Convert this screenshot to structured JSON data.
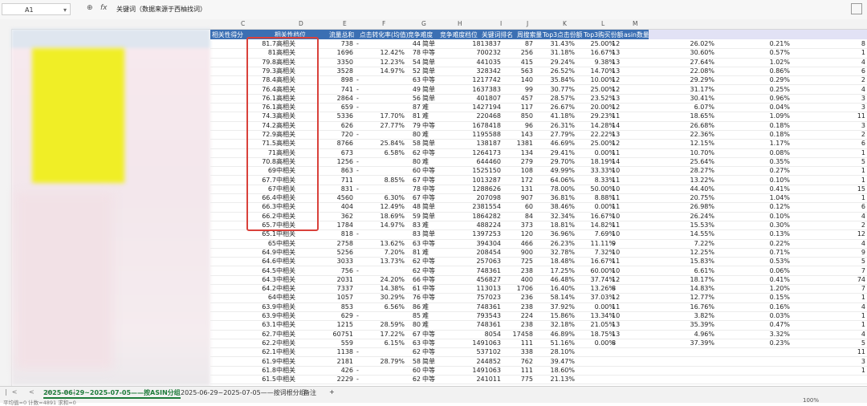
{
  "formula_bar": {
    "cell_ref": "A1",
    "fx_label": "fx",
    "content": "关键词（数据来源于西柚找词）"
  },
  "column_letters": [
    "C",
    "D",
    "E",
    "F",
    "G",
    "H",
    "I",
    "J",
    "K",
    "L",
    "M"
  ],
  "headers": [
    "相关性得分",
    "相关性档位",
    "流量总和",
    "点击转化率(均值)",
    "竞争难度",
    "竞争难度档位",
    "关键词排名",
    "周搜索量",
    "Top3点击份额",
    "Top3购买份额",
    "asin数量"
  ],
  "rows": [
    [
      "81.7",
      "高相关",
      "738",
      "-",
      "44",
      "简单",
      "1813837",
      "87",
      "31.43%",
      "25.00%",
      "12",
      "26.02%",
      "0.21%"
    ],
    [
      "81",
      "高相关",
      "1696",
      "12.42%",
      "78",
      "中等",
      "700232",
      "256",
      "31.18%",
      "16.67%",
      "13",
      "30.60%",
      "0.57%"
    ],
    [
      "79.8",
      "高相关",
      "3350",
      "12.23%",
      "54",
      "简单",
      "441035",
      "415",
      "29.24%",
      "9.38%",
      "13",
      "27.64%",
      "1.02%"
    ],
    [
      "79.3",
      "高相关",
      "3528",
      "14.97%",
      "52",
      "简单",
      "328342",
      "563",
      "26.52%",
      "14.70%",
      "13",
      "22.08%",
      "0.86%"
    ],
    [
      "78.4",
      "高相关",
      "898",
      "-",
      "63",
      "中等",
      "1217742",
      "140",
      "35.84%",
      "10.00%",
      "12",
      "29.29%",
      "0.29%"
    ],
    [
      "76.4",
      "高相关",
      "741",
      "-",
      "49",
      "简单",
      "1637383",
      "99",
      "30.77%",
      "25.00%",
      "12",
      "31.17%",
      "0.25%"
    ],
    [
      "76.1",
      "高相关",
      "2864",
      "-",
      "56",
      "简单",
      "401807",
      "457",
      "28.57%",
      "23.52%",
      "13",
      "30.41%",
      "0.96%"
    ],
    [
      "76.1",
      "高相关",
      "659",
      "-",
      "87",
      "难",
      "1427194",
      "117",
      "26.67%",
      "20.00%",
      "12",
      "6.07%",
      "0.04%"
    ],
    [
      "74.3",
      "高相关",
      "5336",
      "17.70%",
      "81",
      "难",
      "220468",
      "850",
      "41.18%",
      "29.23%",
      "11",
      "18.65%",
      "1.09%"
    ],
    [
      "74.2",
      "高相关",
      "626",
      "27.77%",
      "79",
      "中等",
      "1678418",
      "96",
      "26.31%",
      "14.28%",
      "14",
      "26.68%",
      "0.18%"
    ],
    [
      "72.9",
      "高相关",
      "720",
      "-",
      "80",
      "难",
      "1195588",
      "143",
      "27.79%",
      "22.22%",
      "13",
      "22.36%",
      "0.18%"
    ],
    [
      "71.5",
      "高相关",
      "8766",
      "25.84%",
      "58",
      "简单",
      "138187",
      "1381",
      "46.69%",
      "25.00%",
      "12",
      "12.15%",
      "1.17%"
    ],
    [
      "71",
      "高相关",
      "673",
      "6.58%",
      "62",
      "中等",
      "1264173",
      "134",
      "29.41%",
      "0.00%",
      "11",
      "10.70%",
      "0.08%"
    ],
    [
      "70.8",
      "高相关",
      "1256",
      "-",
      "80",
      "难",
      "644460",
      "279",
      "29.70%",
      "18.19%",
      "14",
      "25.64%",
      "0.35%"
    ],
    [
      "69",
      "中相关",
      "863",
      "-",
      "60",
      "中等",
      "1525150",
      "108",
      "49.99%",
      "33.33%",
      "10",
      "28.27%",
      "0.27%"
    ],
    [
      "67.7",
      "中相关",
      "711",
      "8.85%",
      "67",
      "中等",
      "1013287",
      "172",
      "64.06%",
      "8.33%",
      "11",
      "13.22%",
      "0.10%"
    ],
    [
      "67",
      "中相关",
      "831",
      "-",
      "78",
      "中等",
      "1288626",
      "131",
      "78.00%",
      "50.00%",
      "10",
      "44.40%",
      "0.41%"
    ],
    [
      "66.4",
      "中相关",
      "4560",
      "6.30%",
      "67",
      "中等",
      "207098",
      "907",
      "36.81%",
      "8.88%",
      "11",
      "20.75%",
      "1.04%"
    ],
    [
      "66.3",
      "中相关",
      "404",
      "12.49%",
      "48",
      "简单",
      "2381554",
      "60",
      "38.46%",
      "0.00%",
      "11",
      "26.98%",
      "0.12%"
    ],
    [
      "66.2",
      "中相关",
      "362",
      "18.69%",
      "59",
      "简单",
      "1864282",
      "84",
      "32.34%",
      "16.67%",
      "10",
      "26.24%",
      "0.10%"
    ],
    [
      "65.7",
      "中相关",
      "1784",
      "14.97%",
      "83",
      "难",
      "488224",
      "373",
      "18.81%",
      "14.82%",
      "11",
      "15.53%",
      "0.30%"
    ],
    [
      "65.1",
      "中相关",
      "818",
      "-",
      "83",
      "简单",
      "1397253",
      "120",
      "36.96%",
      "7.69%",
      "10",
      "14.55%",
      "0.13%"
    ],
    [
      "65",
      "中相关",
      "2758",
      "13.62%",
      "63",
      "中等",
      "394304",
      "466",
      "26.23%",
      "11.11%",
      "9",
      "7.22%",
      "0.22%"
    ],
    [
      "64.9",
      "中相关",
      "5256",
      "7.20%",
      "81",
      "难",
      "208454",
      "900",
      "32.78%",
      "7.32%",
      "10",
      "12.25%",
      "0.71%"
    ],
    [
      "64.6",
      "中相关",
      "3033",
      "13.73%",
      "62",
      "中等",
      "257063",
      "725",
      "18.48%",
      "16.67%",
      "11",
      "15.83%",
      "0.53%"
    ],
    [
      "64.5",
      "中相关",
      "756",
      "-",
      "62",
      "中等",
      "748361",
      "238",
      "17.25%",
      "60.00%",
      "10",
      "6.61%",
      "0.06%"
    ],
    [
      "64.3",
      "中相关",
      "2031",
      "24.20%",
      "66",
      "中等",
      "456827",
      "400",
      "46.48%",
      "37.74%",
      "12",
      "18.17%",
      "0.41%"
    ],
    [
      "64.2",
      "中相关",
      "7337",
      "14.38%",
      "61",
      "中等",
      "113013",
      "1706",
      "16.40%",
      "13.26%",
      "8",
      "14.83%",
      "1.20%"
    ],
    [
      "64",
      "中相关",
      "1057",
      "30.29%",
      "76",
      "中等",
      "757023",
      "236",
      "58.14%",
      "37.03%",
      "12",
      "12.77%",
      "0.15%"
    ],
    [
      "63.9",
      "中相关",
      "853",
      "6.56%",
      "86",
      "难",
      "748361",
      "238",
      "37.92%",
      "0.00%",
      "11",
      "16.76%",
      "0.16%"
    ],
    [
      "63.9",
      "中相关",
      "629",
      "-",
      "85",
      "难",
      "793543",
      "224",
      "15.86%",
      "13.34%",
      "10",
      "3.82%",
      "0.03%"
    ],
    [
      "63.1",
      "中相关",
      "1215",
      "28.59%",
      "80",
      "难",
      "748361",
      "238",
      "32.18%",
      "21.05%",
      "13",
      "35.39%",
      "0.47%"
    ],
    [
      "62.7",
      "中相关",
      "60751",
      "17.22%",
      "67",
      "中等",
      "8054",
      "17458",
      "46.89%",
      "18.75%",
      "13",
      "4.96%",
      "3.32%"
    ],
    [
      "62.2",
      "中相关",
      "559",
      "6.15%",
      "63",
      "中等",
      "1491063",
      "111",
      "51.16%",
      "0.00%",
      "8",
      "37.39%",
      "0.23%"
    ],
    [
      "62.1",
      "中相关",
      "1138",
      "-",
      "62",
      "中等",
      "537102",
      "338",
      "28.10%",
      "",
      "",
      "",
      ""
    ],
    [
      "61.9",
      "中相关",
      "2181",
      "28.79%",
      "58",
      "简单",
      "244852",
      "762",
      "39.47%",
      "",
      "",
      "",
      ""
    ],
    [
      "61.8",
      "中相关",
      "426",
      "-",
      "60",
      "中等",
      "1491063",
      "111",
      "18.60%",
      "",
      "",
      "",
      ""
    ],
    [
      "61.5",
      "中相关",
      "2229",
      "-",
      "62",
      "中等",
      "241011",
      "775",
      "21.13%",
      "",
      "",
      "",
      ""
    ]
  ],
  "right_edge_values": [
    "8",
    "1",
    "4",
    "6",
    "2",
    "4",
    "3",
    "3",
    "11",
    "3",
    "2",
    "6",
    "1",
    "5",
    "1",
    "1",
    "15",
    "1",
    "6",
    "4",
    "2",
    "12",
    "4",
    "9",
    "5",
    "7",
    "74",
    "7",
    "1",
    "4",
    "1",
    "1",
    "4",
    "5",
    "11",
    "3",
    "1"
  ],
  "sheet_tabs": [
    {
      "label": "2025-06-29~2025-07-05——按ASIN分组",
      "active": true
    },
    {
      "label": "2025-06-29~2025-07-05——按词根分组",
      "active": false
    },
    {
      "label": "备注",
      "active": false
    }
  ],
  "status": {
    "left": "平均值=0   计数=4891   求和=0",
    "zoom": "100%"
  },
  "colors": {
    "header_blue": "#3b6fb3",
    "red_box": "#d9413b",
    "active_tab": "#1e7b3a"
  }
}
